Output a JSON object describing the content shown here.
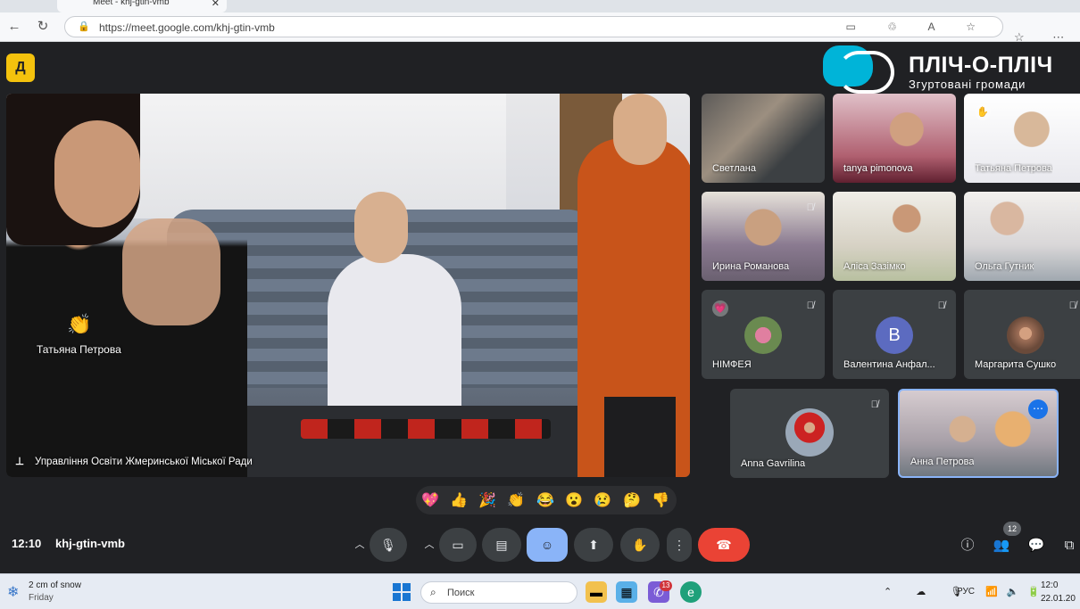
{
  "browser": {
    "tab_title": "Meet - khj-gtin-vmb",
    "url": "https://meet.google.com/khj-gtin-vmb"
  },
  "meet": {
    "badge_letter": "Д",
    "logo": {
      "title": "ПЛІЧ-О-ПЛІЧ",
      "subtitle": "Згуртовані громади",
      "accent_color": "#00b4d8"
    },
    "main_video": {
      "name_tag": "Татьяна Петрова",
      "presenter": "Управління Освіти Жмеринської Міської Ради"
    },
    "tiles": [
      {
        "name": "Светлана",
        "muted": false
      },
      {
        "name": "tanya pimonova",
        "muted": false
      },
      {
        "name": "Татьяна Петрова",
        "muted": false,
        "reaction": "hand"
      },
      {
        "name": "Ирина Романова",
        "muted": true
      },
      {
        "name": "Аліса Зазімко",
        "muted": false
      },
      {
        "name": "Ольга Гутник",
        "muted": true
      },
      {
        "name": "НІМФЕЯ",
        "muted": true,
        "reaction": "heart"
      },
      {
        "name": "Валентина Анфал...",
        "muted": true,
        "avatar_letter": "В"
      },
      {
        "name": "Маргарита Сушко",
        "muted": true
      },
      {
        "name": "Anna Gavrilina",
        "muted": true
      },
      {
        "name": "Анна Петрова",
        "muted": false,
        "active": true
      }
    ],
    "reactions": [
      "💖",
      "👍",
      "🎉",
      "👏",
      "😂",
      "😮",
      "😢",
      "🤔",
      "👎"
    ],
    "bottom": {
      "time": "12:10",
      "code": "khj-gtin-vmb",
      "people_count": "12"
    }
  },
  "taskbar": {
    "weather_line1": "2 cm of snow",
    "weather_line2": "Friday",
    "search_placeholder": "Поиск",
    "language": "РУС",
    "clock_time": "12:0",
    "clock_date": "22.01.20",
    "badge": "13"
  }
}
